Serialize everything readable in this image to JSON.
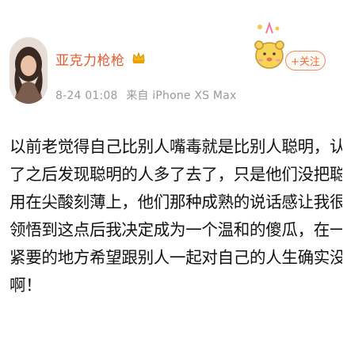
{
  "post": {
    "author": {
      "name": "亚克力枪枪",
      "badge_icon": "vip-crown-icon"
    },
    "meta": {
      "time": "8-24 01:08",
      "source": "来自 iPhone XS Max"
    },
    "follow": {
      "label": "+关注",
      "decoration_icon": "cartoon-bear-balloon-icon"
    },
    "content_lines": [
      "以前老觉得自己比别人嘴毒就是比别人聪明，认识人多",
      "了之后发现聪明的人多了去了，只是他们没把聪明劲儿",
      "用在尖酸刻薄上，他们那种成熟的说话感让我很自卑。",
      "领悟到这点后我决定成为一个温和的傻瓜，在一些无关",
      "紧要的地方希望跟别人一起对自己的人生确实没啥好处",
      "啊！"
    ]
  },
  "colors": {
    "name": "#e8582a",
    "meta": "#9a9a9a",
    "text": "#111111",
    "follow": "#f06d3c"
  }
}
